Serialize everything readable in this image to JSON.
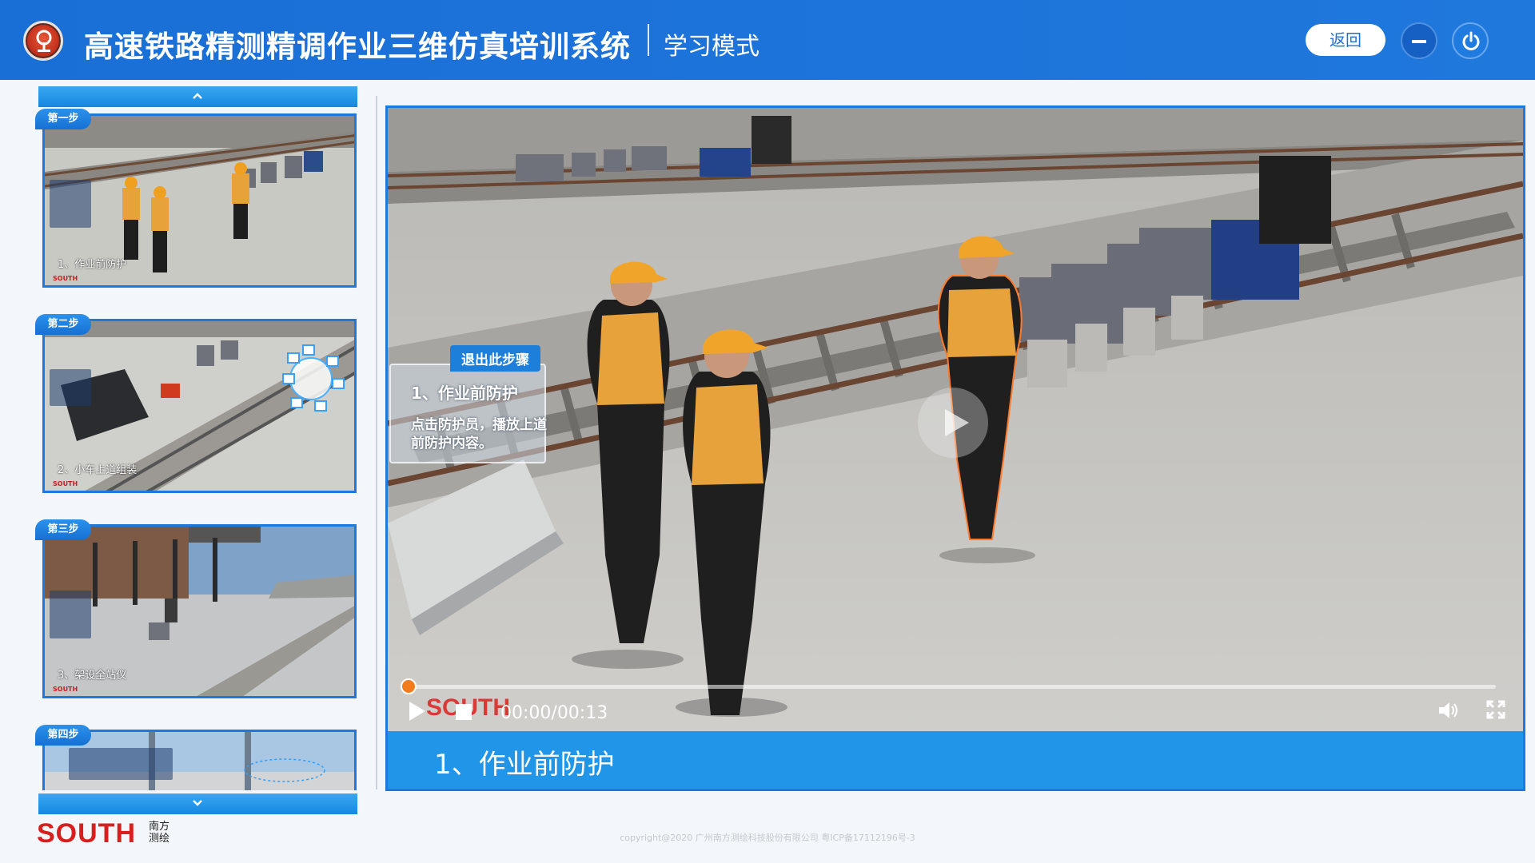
{
  "header": {
    "title": "高速铁路精测精调作业三维仿真培训系统",
    "mode": "学习模式",
    "back_label": "返回",
    "icons": {
      "logo": "railway-logo-icon",
      "minimize": "minimize-icon",
      "power": "power-icon"
    }
  },
  "sidebar": {
    "steps": [
      {
        "badge": "第一步",
        "caption": "1、作业前防护"
      },
      {
        "badge": "第二步",
        "caption": "2、小车上道组装"
      },
      {
        "badge": "第三步",
        "caption": "3、架设全站仪"
      },
      {
        "badge": "第四步",
        "caption": ""
      }
    ]
  },
  "player": {
    "exit_label": "退出此步骤",
    "info_title": "1、作业前防护",
    "info_desc": "点击防护员，播放上道前防护内容。",
    "watermark": "SOUTH",
    "time": "00:00/00:13",
    "progress": 0.0,
    "caption": "1、作业前防护"
  },
  "brand": {
    "name": "SOUTH",
    "name_cn": "南方测绘"
  },
  "footer": {
    "copyright": "copyright@2020 广州南方测绘科技股份有限公司 粤ICP备17112196号-3"
  },
  "colors": {
    "header": "#1d74da",
    "accent": "#2196e8",
    "progress": "#f27b1b",
    "brand_red": "#d81e1e"
  }
}
